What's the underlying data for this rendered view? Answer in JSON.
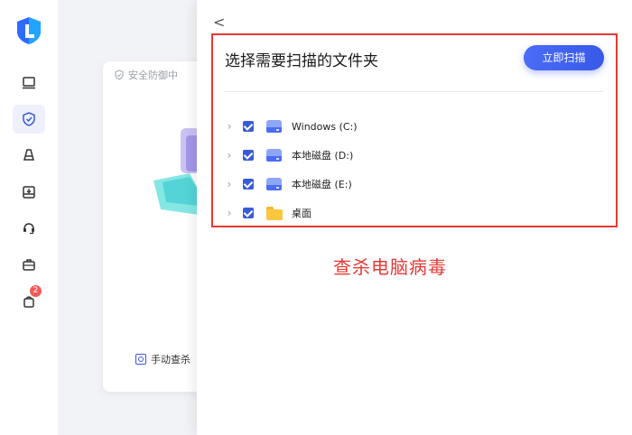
{
  "background": {
    "status_text": "安全防御中",
    "manual_scan_label": "手动查杀"
  },
  "nav": {
    "items": [
      {
        "name": "computer"
      },
      {
        "name": "shield"
      },
      {
        "name": "cleanup"
      },
      {
        "name": "toolbox"
      },
      {
        "name": "support"
      },
      {
        "name": "briefcase"
      },
      {
        "name": "shop",
        "badge": "2"
      }
    ]
  },
  "drawer": {
    "back_label": "<",
    "title": "选择需要扫描的文件夹",
    "scan_button_label": "立即扫描",
    "folders": [
      {
        "label": "Windows (C:)",
        "icon": "drive-icon",
        "checked": true
      },
      {
        "label": "本地磁盘 (D:)",
        "icon": "drive-icon",
        "checked": true
      },
      {
        "label": "本地磁盘 (E:)",
        "icon": "drive-icon",
        "checked": true
      },
      {
        "label": "桌面",
        "icon": "folder-icon",
        "checked": true
      }
    ]
  },
  "annotation": {
    "text": "查杀电脑病毒"
  },
  "colors": {
    "accent": "#3a5bd9",
    "annotation_red": "#e53935"
  }
}
